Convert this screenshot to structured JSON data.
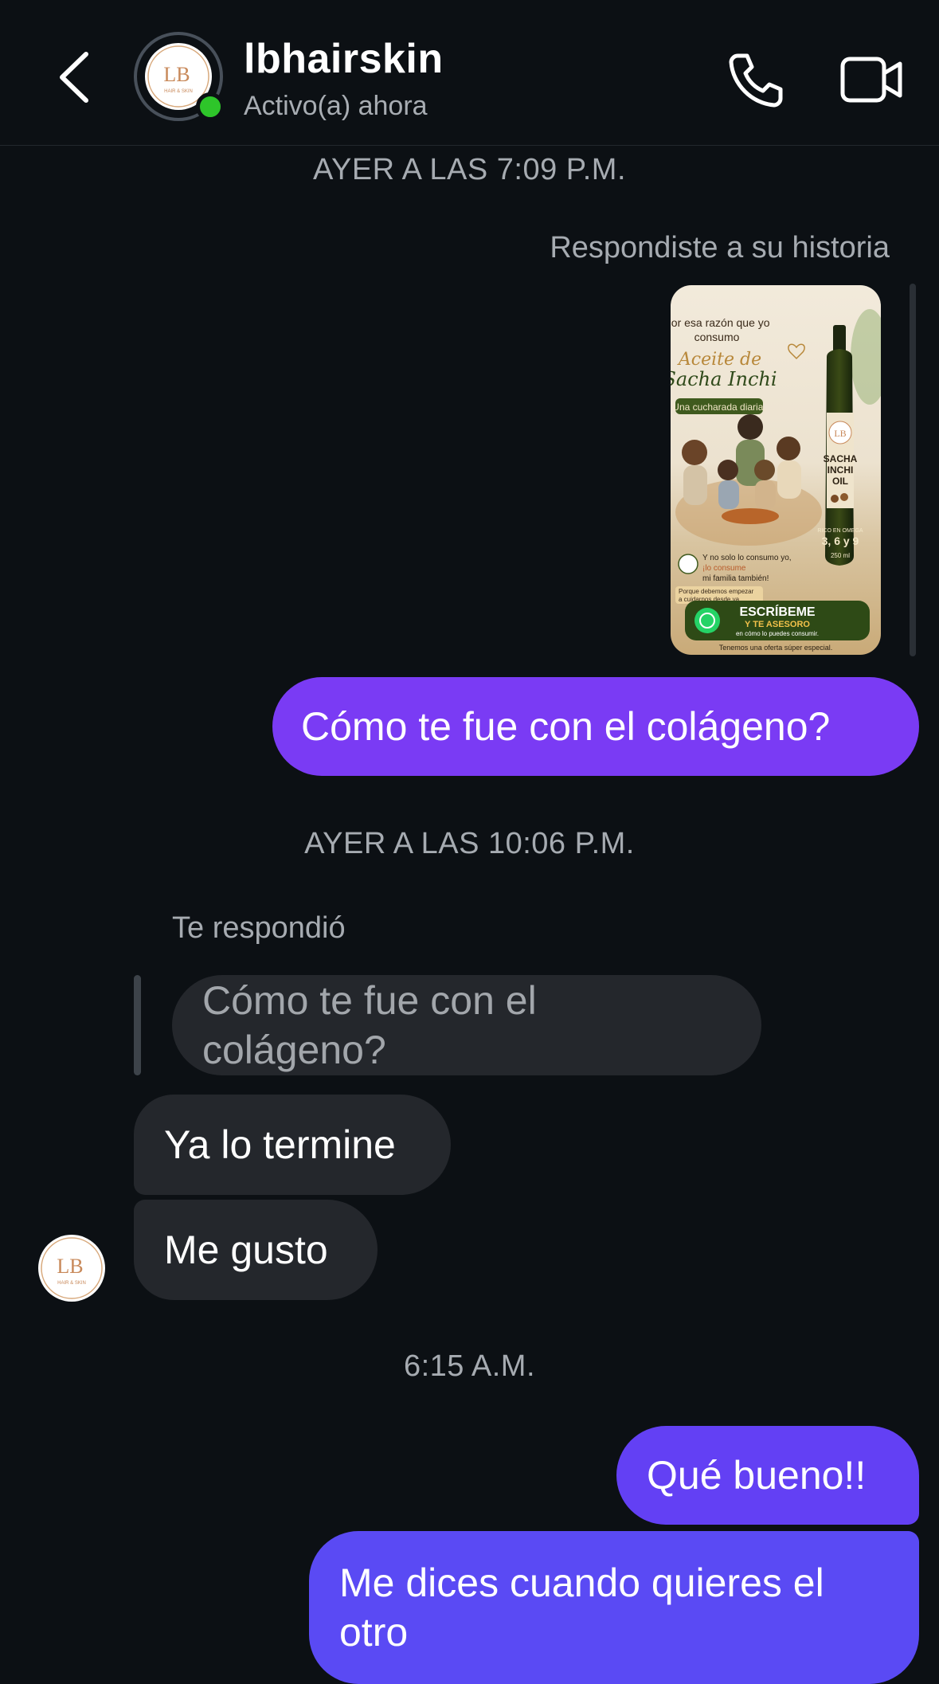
{
  "header": {
    "contact_name": "lbhairskin",
    "status": "Activo(a) ahora",
    "logo_text": "LB",
    "logo_subtext": "HAIR & SKIN"
  },
  "timestamps": {
    "first": "AYER A LAS 7:09 P.M.",
    "second": "AYER A LAS 10:06 P.M.",
    "third": "6:15 A.M."
  },
  "story_reply": {
    "label": "Respondiste a su historia",
    "card": {
      "line1": "Por esa razón que yo",
      "line2": "consumo",
      "script1": "Aceite de",
      "script2": "Sacha Inchi",
      "tagline": "Una cucharada diaria.",
      "bottle_label1": "SACHA",
      "bottle_label2": "INCHI",
      "bottle_label3": "OIL",
      "omega_small": "RICO EN OMEGA",
      "omega": "3, 6 y 9",
      "volume": "250 ml",
      "family1": "Y no solo lo consumo yo,",
      "family2": "¡lo consume",
      "family3": "mi familia también!",
      "start1": "Porque debemos empezar",
      "start2": "a cuidarnos desde ya.",
      "cta1": "ESCRÍBEME",
      "cta2": "Y TE ASESORO",
      "cta3": "en cómo lo puedes consumir.",
      "offer": "Tenemos una oferta súper especial."
    }
  },
  "messages": {
    "m1": "Cómo te fue con el colágeno?",
    "replied_label": "Te respondió",
    "quoted": "Cómo te fue con el colágeno?",
    "m2": "Ya lo termine",
    "m3": "Me gusto",
    "m4": "Qué bueno!!",
    "m5": "Me dices cuando quieres el otro"
  },
  "colors": {
    "background": "#0c1014",
    "outgoing_purple": "#7a3bf4",
    "outgoing_indigo": "#5a4af4",
    "incoming": "#24272c",
    "online": "#2ec52a"
  },
  "icons": [
    "back-chevron-icon",
    "phone-icon",
    "video-camera-icon"
  ]
}
